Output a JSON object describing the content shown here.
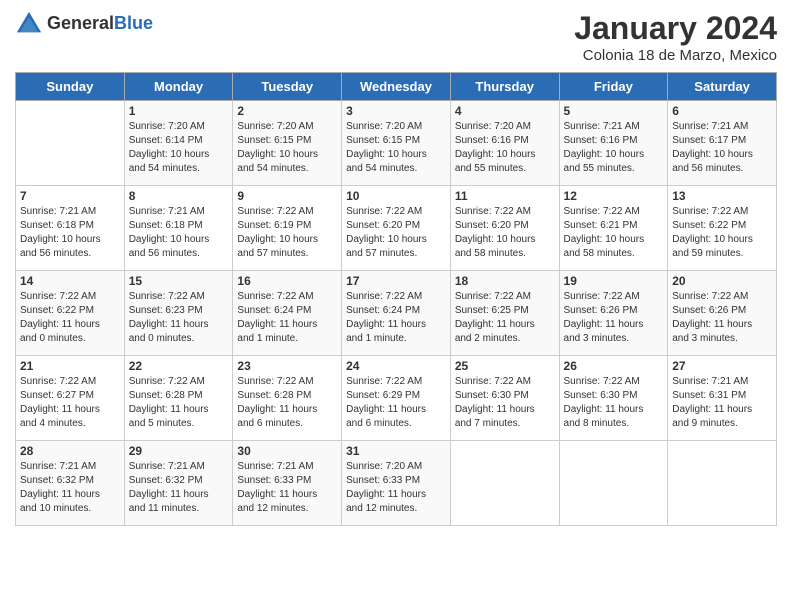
{
  "logo": {
    "general": "General",
    "blue": "Blue"
  },
  "title": "January 2024",
  "subtitle": "Colonia 18 de Marzo, Mexico",
  "headers": [
    "Sunday",
    "Monday",
    "Tuesday",
    "Wednesday",
    "Thursday",
    "Friday",
    "Saturday"
  ],
  "weeks": [
    [
      {
        "num": "",
        "info": ""
      },
      {
        "num": "1",
        "info": "Sunrise: 7:20 AM\nSunset: 6:14 PM\nDaylight: 10 hours\nand 54 minutes."
      },
      {
        "num": "2",
        "info": "Sunrise: 7:20 AM\nSunset: 6:15 PM\nDaylight: 10 hours\nand 54 minutes."
      },
      {
        "num": "3",
        "info": "Sunrise: 7:20 AM\nSunset: 6:15 PM\nDaylight: 10 hours\nand 54 minutes."
      },
      {
        "num": "4",
        "info": "Sunrise: 7:20 AM\nSunset: 6:16 PM\nDaylight: 10 hours\nand 55 minutes."
      },
      {
        "num": "5",
        "info": "Sunrise: 7:21 AM\nSunset: 6:16 PM\nDaylight: 10 hours\nand 55 minutes."
      },
      {
        "num": "6",
        "info": "Sunrise: 7:21 AM\nSunset: 6:17 PM\nDaylight: 10 hours\nand 56 minutes."
      }
    ],
    [
      {
        "num": "7",
        "info": "Sunrise: 7:21 AM\nSunset: 6:18 PM\nDaylight: 10 hours\nand 56 minutes."
      },
      {
        "num": "8",
        "info": "Sunrise: 7:21 AM\nSunset: 6:18 PM\nDaylight: 10 hours\nand 56 minutes."
      },
      {
        "num": "9",
        "info": "Sunrise: 7:22 AM\nSunset: 6:19 PM\nDaylight: 10 hours\nand 57 minutes."
      },
      {
        "num": "10",
        "info": "Sunrise: 7:22 AM\nSunset: 6:20 PM\nDaylight: 10 hours\nand 57 minutes."
      },
      {
        "num": "11",
        "info": "Sunrise: 7:22 AM\nSunset: 6:20 PM\nDaylight: 10 hours\nand 58 minutes."
      },
      {
        "num": "12",
        "info": "Sunrise: 7:22 AM\nSunset: 6:21 PM\nDaylight: 10 hours\nand 58 minutes."
      },
      {
        "num": "13",
        "info": "Sunrise: 7:22 AM\nSunset: 6:22 PM\nDaylight: 10 hours\nand 59 minutes."
      }
    ],
    [
      {
        "num": "14",
        "info": "Sunrise: 7:22 AM\nSunset: 6:22 PM\nDaylight: 11 hours\nand 0 minutes."
      },
      {
        "num": "15",
        "info": "Sunrise: 7:22 AM\nSunset: 6:23 PM\nDaylight: 11 hours\nand 0 minutes."
      },
      {
        "num": "16",
        "info": "Sunrise: 7:22 AM\nSunset: 6:24 PM\nDaylight: 11 hours\nand 1 minute."
      },
      {
        "num": "17",
        "info": "Sunrise: 7:22 AM\nSunset: 6:24 PM\nDaylight: 11 hours\nand 1 minute."
      },
      {
        "num": "18",
        "info": "Sunrise: 7:22 AM\nSunset: 6:25 PM\nDaylight: 11 hours\nand 2 minutes."
      },
      {
        "num": "19",
        "info": "Sunrise: 7:22 AM\nSunset: 6:26 PM\nDaylight: 11 hours\nand 3 minutes."
      },
      {
        "num": "20",
        "info": "Sunrise: 7:22 AM\nSunset: 6:26 PM\nDaylight: 11 hours\nand 3 minutes."
      }
    ],
    [
      {
        "num": "21",
        "info": "Sunrise: 7:22 AM\nSunset: 6:27 PM\nDaylight: 11 hours\nand 4 minutes."
      },
      {
        "num": "22",
        "info": "Sunrise: 7:22 AM\nSunset: 6:28 PM\nDaylight: 11 hours\nand 5 minutes."
      },
      {
        "num": "23",
        "info": "Sunrise: 7:22 AM\nSunset: 6:28 PM\nDaylight: 11 hours\nand 6 minutes."
      },
      {
        "num": "24",
        "info": "Sunrise: 7:22 AM\nSunset: 6:29 PM\nDaylight: 11 hours\nand 6 minutes."
      },
      {
        "num": "25",
        "info": "Sunrise: 7:22 AM\nSunset: 6:30 PM\nDaylight: 11 hours\nand 7 minutes."
      },
      {
        "num": "26",
        "info": "Sunrise: 7:22 AM\nSunset: 6:30 PM\nDaylight: 11 hours\nand 8 minutes."
      },
      {
        "num": "27",
        "info": "Sunrise: 7:21 AM\nSunset: 6:31 PM\nDaylight: 11 hours\nand 9 minutes."
      }
    ],
    [
      {
        "num": "28",
        "info": "Sunrise: 7:21 AM\nSunset: 6:32 PM\nDaylight: 11 hours\nand 10 minutes."
      },
      {
        "num": "29",
        "info": "Sunrise: 7:21 AM\nSunset: 6:32 PM\nDaylight: 11 hours\nand 11 minutes."
      },
      {
        "num": "30",
        "info": "Sunrise: 7:21 AM\nSunset: 6:33 PM\nDaylight: 11 hours\nand 12 minutes."
      },
      {
        "num": "31",
        "info": "Sunrise: 7:20 AM\nSunset: 6:33 PM\nDaylight: 11 hours\nand 12 minutes."
      },
      {
        "num": "",
        "info": ""
      },
      {
        "num": "",
        "info": ""
      },
      {
        "num": "",
        "info": ""
      }
    ]
  ]
}
